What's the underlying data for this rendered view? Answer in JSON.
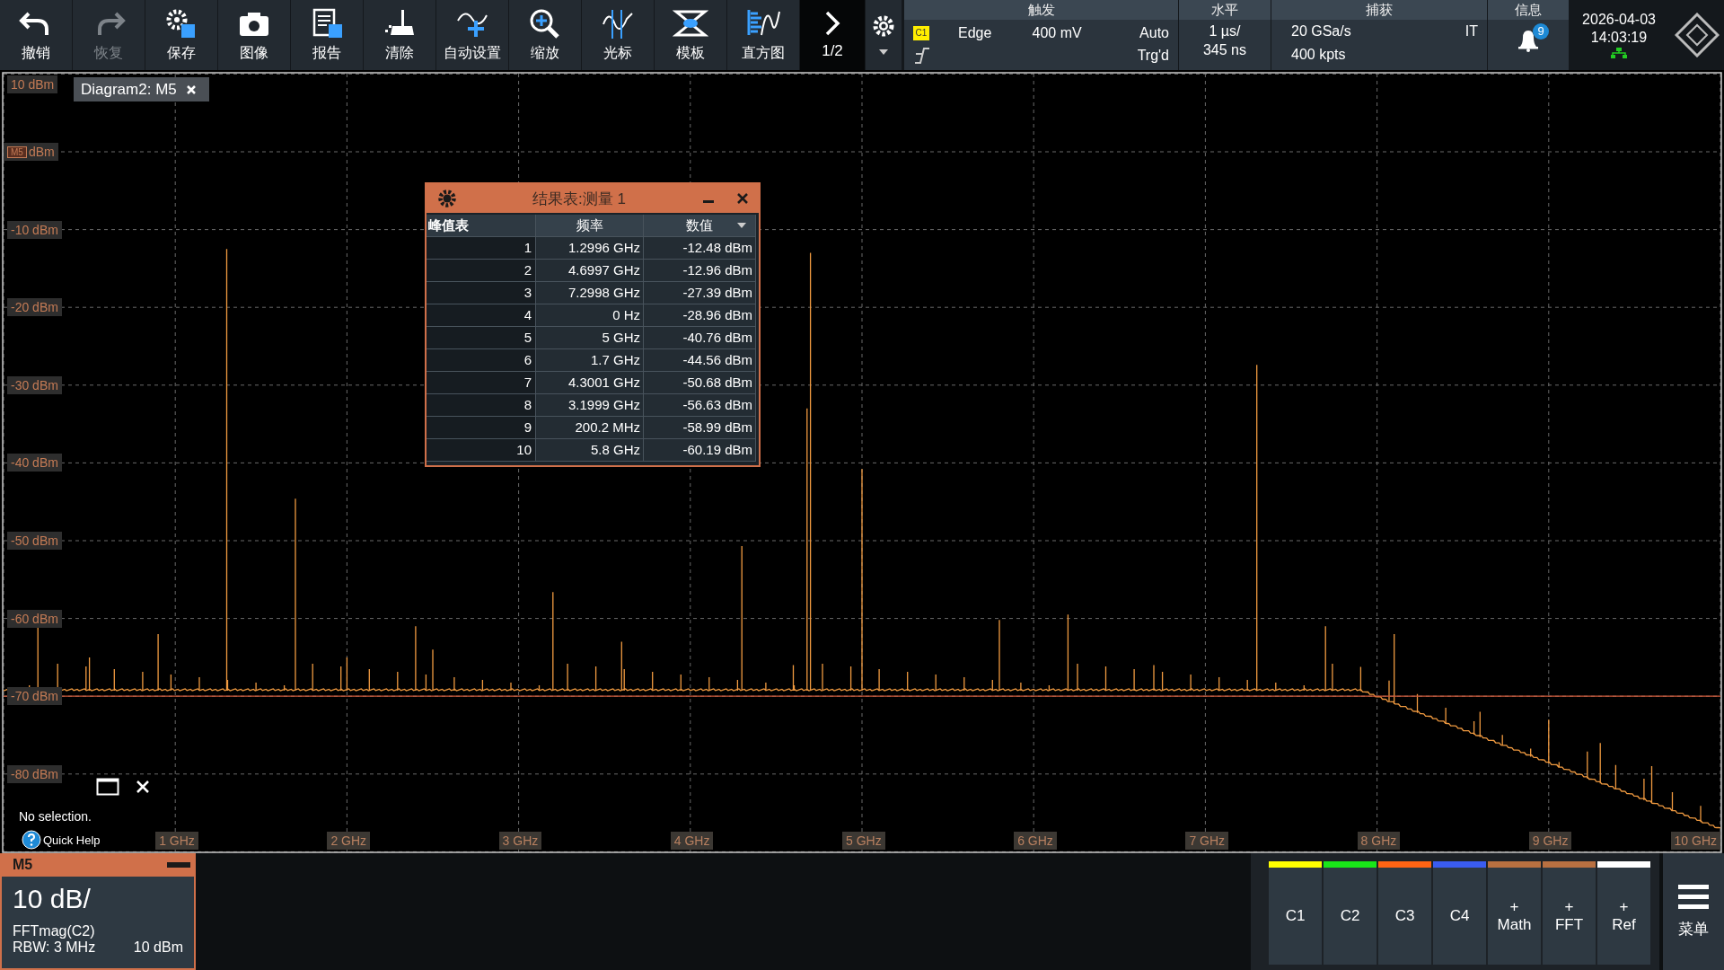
{
  "toolbar": {
    "buttons": [
      {
        "label": "撤销",
        "disabled": false
      },
      {
        "label": "恢复",
        "disabled": true
      },
      {
        "label": "保存",
        "disabled": false
      },
      {
        "label": "图像",
        "disabled": false
      },
      {
        "label": "报告",
        "disabled": false
      },
      {
        "label": "清除",
        "disabled": false
      },
      {
        "label": "自动设置",
        "disabled": false
      },
      {
        "label": "缩放",
        "disabled": false
      },
      {
        "label": "光标",
        "disabled": false
      },
      {
        "label": "模板",
        "disabled": false
      },
      {
        "label": "直方图",
        "disabled": false
      }
    ],
    "page": "1/2"
  },
  "trigger": {
    "title": "触发",
    "source": "C1",
    "type": "Edge",
    "level": "400 mV",
    "mode": "Auto",
    "state": "Trg'd"
  },
  "horizontal": {
    "title": "水平",
    "scale": "1 µs/",
    "position": "345 ns"
  },
  "acquisition": {
    "title": "捕获",
    "rate": "20 GSa/s",
    "mode": "IT",
    "points": "400 kpts"
  },
  "info": {
    "title": "信息",
    "count": "9"
  },
  "clock": {
    "date": "2026-04-03",
    "time": "14:03:19"
  },
  "diagram": {
    "tab": "Diagram2: M5",
    "marker": "M5",
    "y_labels": [
      "10 dBm",
      "dBm",
      "-10 dBm",
      "-20 dBm",
      "-30 dBm",
      "-40 dBm",
      "-50 dBm",
      "-60 dBm",
      "-70 dBm",
      "-80 dBm"
    ],
    "x_labels": [
      "1 GHz",
      "2 GHz",
      "3 GHz",
      "4 GHz",
      "5 GHz",
      "6 GHz",
      "7 GHz",
      "8 GHz",
      "9 GHz",
      "10 GHz"
    ]
  },
  "results": {
    "title": "结果表:测量 1",
    "corner": "峰值表",
    "columns": [
      "频率",
      "数值"
    ],
    "rows": [
      {
        "index": "1",
        "frequency": "1.2996 GHz",
        "value": "-12.48 dBm"
      },
      {
        "index": "2",
        "frequency": "4.6997 GHz",
        "value": "-12.96 dBm"
      },
      {
        "index": "3",
        "frequency": "7.2998 GHz",
        "value": "-27.39 dBm"
      },
      {
        "index": "4",
        "frequency": "0 Hz",
        "value": "-28.96 dBm"
      },
      {
        "index": "5",
        "frequency": "5 GHz",
        "value": "-40.76 dBm"
      },
      {
        "index": "6",
        "frequency": "1.7 GHz",
        "value": "-44.56 dBm"
      },
      {
        "index": "7",
        "frequency": "4.3001 GHz",
        "value": "-50.68 dBm"
      },
      {
        "index": "8",
        "frequency": "3.1999 GHz",
        "value": "-56.63 dBm"
      },
      {
        "index": "9",
        "frequency": "200.2 MHz",
        "value": "-58.99 dBm"
      },
      {
        "index": "10",
        "frequency": "5.8 GHz",
        "value": "-60.19 dBm"
      }
    ]
  },
  "help": {
    "message": "No selection.",
    "link": "Quick Help"
  },
  "signal": {
    "name": "M5",
    "scale": "10 dB/",
    "source": "FFTmag(C2)",
    "rbw": "RBW: 3 MHz",
    "reference": "10 dBm"
  },
  "channels": [
    {
      "label": "C1",
      "color": "#ffff00"
    },
    {
      "label": "C2",
      "color": "#19e619"
    },
    {
      "label": "C3",
      "color": "#ff6414"
    },
    {
      "label": "C4",
      "color": "#3a5cf0"
    },
    {
      "label": "Math",
      "prefix": "+",
      "color": "#b87040"
    },
    {
      "label": "FFT",
      "prefix": "+",
      "color": "#b87041"
    },
    {
      "label": "Ref",
      "prefix": "+",
      "color": "#ffffff"
    }
  ],
  "menu": {
    "label": "菜单"
  }
}
